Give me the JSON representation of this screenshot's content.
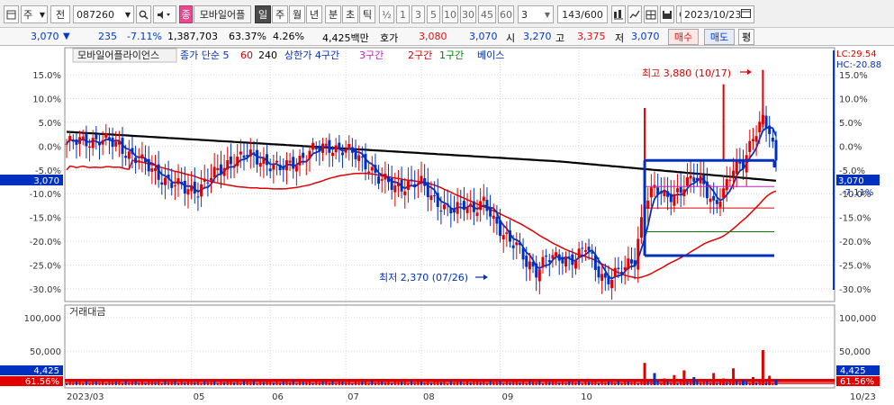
{
  "toolbar": {
    "market_label": "주",
    "type_label": "전",
    "stock_code": "087260",
    "stock_badge": "종",
    "stock_name": "모바일어플",
    "periods": [
      "일",
      "주",
      "월",
      "년",
      "분",
      "초",
      "틱"
    ],
    "half_label": "½",
    "minute_options": [
      "1",
      "3",
      "5",
      "10",
      "30",
      "45",
      "60"
    ],
    "count_select": "3",
    "page_count": "143/600",
    "date": "2023/10/23"
  },
  "quote": {
    "price": "3,070",
    "direction_glyph": "▼",
    "change": "235",
    "change_pct": "-7.11%",
    "volume": "1,387,703",
    "volume_ratio": "63.37%",
    "turnover_pct": "4.26%",
    "amount": "4,425백만",
    "bid_label": "호가",
    "bid_price": "3,080",
    "ask_price": "3,070",
    "open_label": "시",
    "open": "3,270",
    "high_label": "고",
    "high": "3,375",
    "low_label": "저",
    "low": "3,070",
    "buy_button": "매수",
    "sell_button": "매도",
    "eval_button": "평"
  },
  "chart": {
    "legend_name": "모바일어플라이언스",
    "legend_items": [
      {
        "text": "종가 단순 5",
        "color": "#0030c0"
      },
      {
        "text": "60",
        "color": "#e00000"
      },
      {
        "text": "240",
        "color": "#000000"
      },
      {
        "text": "상한가 4구간",
        "color": "#0030c0"
      },
      {
        "text": "3구간",
        "color": "#c020c0"
      },
      {
        "text": "2구간",
        "color": "#e00000"
      },
      {
        "text": "1구간",
        "color": "#008000"
      },
      {
        "text": "베이스",
        "color": "#0030c0"
      }
    ],
    "high_annotation": "최고 3,880 (10/17)",
    "low_annotation": "최저 2,370 (07/26)",
    "lc_label": "LC:29.54",
    "hc_label": "HC:-20.88",
    "current_price_tag": "3,070",
    "current_pct_tag": "-7.11%",
    "volume_title": "거래대금",
    "volume_value_tag": "4,425",
    "volume_pct_tag": "61.56%",
    "colors": {
      "up": "#e00000",
      "down": "#0030c0",
      "ma5": "#0030c0",
      "ma60": "#e00000",
      "ma240": "#000000"
    }
  },
  "chart_data": {
    "type": "candlestick",
    "y_axis_ticks": [
      "15.0%",
      "10.0%",
      "5.0%",
      "0.0%",
      "-5.0%",
      "-10.0%",
      "-15.0%",
      "-20.0%",
      "-25.0%",
      "-30.0%"
    ],
    "y_range_pct": [
      -31.5,
      19
    ],
    "volume_ticks": [
      "100,000",
      "50,000"
    ],
    "x_tick_labels": [
      "2023/03",
      "05",
      "06",
      "07",
      "08",
      "09",
      "10",
      "10/23"
    ],
    "price_high": 3880,
    "price_high_date": "10/17",
    "price_low": 2370,
    "price_low_date": "07/26",
    "last_close": 3070,
    "close_path_pct": [
      [
        0,
        0.5
      ],
      [
        10,
        1.5
      ],
      [
        16,
        0
      ],
      [
        22,
        -3
      ],
      [
        26,
        -5
      ],
      [
        32,
        -8
      ],
      [
        36,
        -9
      ],
      [
        40,
        -9
      ],
      [
        45,
        -6
      ],
      [
        50,
        -3
      ],
      [
        55,
        -2
      ],
      [
        60,
        -3
      ],
      [
        65,
        -5
      ],
      [
        70,
        -3
      ],
      [
        75,
        -1
      ],
      [
        80,
        0
      ],
      [
        85,
        -1
      ],
      [
        88,
        -2
      ],
      [
        92,
        -4
      ],
      [
        95,
        -7
      ],
      [
        100,
        -8.5
      ],
      [
        104,
        -8
      ],
      [
        108,
        -8
      ],
      [
        112,
        -11
      ],
      [
        115,
        -13
      ],
      [
        118,
        -14
      ],
      [
        121,
        -12
      ],
      [
        124,
        -13
      ],
      [
        127,
        -12
      ],
      [
        130,
        -16
      ],
      [
        133,
        -18
      ],
      [
        137,
        -21
      ],
      [
        140,
        -25
      ],
      [
        143,
        -26
      ],
      [
        146,
        -23
      ],
      [
        149,
        -24
      ],
      [
        152,
        -24
      ],
      [
        155,
        -23
      ],
      [
        158,
        -21
      ],
      [
        161,
        -26
      ],
      [
        164,
        -28
      ],
      [
        167,
        -26.5
      ],
      [
        170,
        -26
      ],
      [
        173,
        -24
      ],
      [
        176,
        -11
      ],
      [
        179,
        -9
      ],
      [
        182,
        -11
      ],
      [
        185,
        -10
      ],
      [
        188,
        -8
      ],
      [
        191,
        -7
      ],
      [
        194,
        -8
      ],
      [
        197,
        -12
      ],
      [
        200,
        -10
      ],
      [
        203,
        -5
      ],
      [
        206,
        -3
      ],
      [
        209,
        2
      ],
      [
        212,
        5
      ],
      [
        214,
        3
      ],
      [
        216,
        -3
      ]
    ],
    "volume_spikes": [
      [
        176,
        33
      ],
      [
        179,
        18
      ],
      [
        182,
        10
      ],
      [
        185,
        15
      ],
      [
        188,
        22
      ],
      [
        191,
        12
      ],
      [
        197,
        18
      ],
      [
        200,
        10
      ],
      [
        203,
        25
      ],
      [
        206,
        7
      ],
      [
        209,
        12
      ],
      [
        212,
        52
      ],
      [
        214,
        14
      ],
      [
        216,
        8
      ]
    ],
    "levels_pct": {
      "upper_4": -3,
      "band_3": -8.5,
      "band_2": -13,
      "band_1": -18,
      "base": -23
    }
  }
}
